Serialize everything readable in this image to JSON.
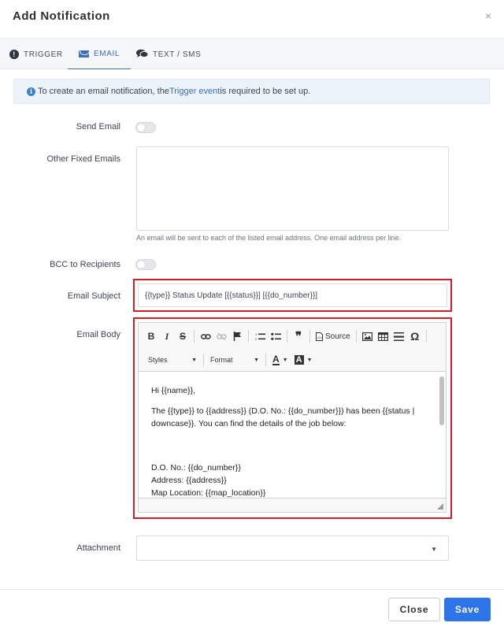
{
  "dialog": {
    "title": "Add Notification",
    "close_glyph": "×"
  },
  "tabs": [
    {
      "label": "TRIGGER",
      "icon": "exclamation-circle-icon",
      "active": false
    },
    {
      "label": "EMAIL",
      "icon": "envelope-icon",
      "active": true
    },
    {
      "label": "TEXT / SMS",
      "icon": "chat-bubbles-icon",
      "active": false
    }
  ],
  "info": {
    "text_before": "To create an email notification, the ",
    "link": "Trigger event",
    "text_after": " is required to be set up."
  },
  "form": {
    "send_email": {
      "label": "Send Email",
      "enabled": false
    },
    "other_fixed_emails": {
      "label": "Other Fixed Emails",
      "value": "",
      "help": "An email will be sent to each of the listed email address. One email address per line."
    },
    "bcc": {
      "label": "BCC to Recipients",
      "enabled": false
    },
    "subject": {
      "label": "Email Subject",
      "value": "{{type}} Status Update [{{status}}] [{{do_number}}]"
    },
    "body": {
      "label": "Email Body",
      "toolbar": {
        "bold": "B",
        "italic": "I",
        "strike": "S",
        "source": "Source",
        "quote": "❞",
        "special_char": "Ω",
        "styles": "Styles",
        "format": "Format",
        "text_color": "A",
        "bg_color": "A"
      },
      "paragraphs": [
        "Hi {{name}},",
        "The {{type}} to {{address}} (D.O. No.: {{do_number}}) has been {{status | downcase}}. You can find the details of the job below:"
      ],
      "lines": [
        "D.O. No.: {{do_number}}",
        "Address: {{address}}",
        "Map Location: {{map_location}}"
      ]
    },
    "attachment": {
      "label": "Attachment",
      "value": ""
    }
  },
  "buttons": {
    "close": "Close",
    "save": "Save"
  },
  "colors": {
    "accent": "#2d74e8",
    "highlight_border": "#d11f2a",
    "info_bg": "#ecf3fb"
  }
}
